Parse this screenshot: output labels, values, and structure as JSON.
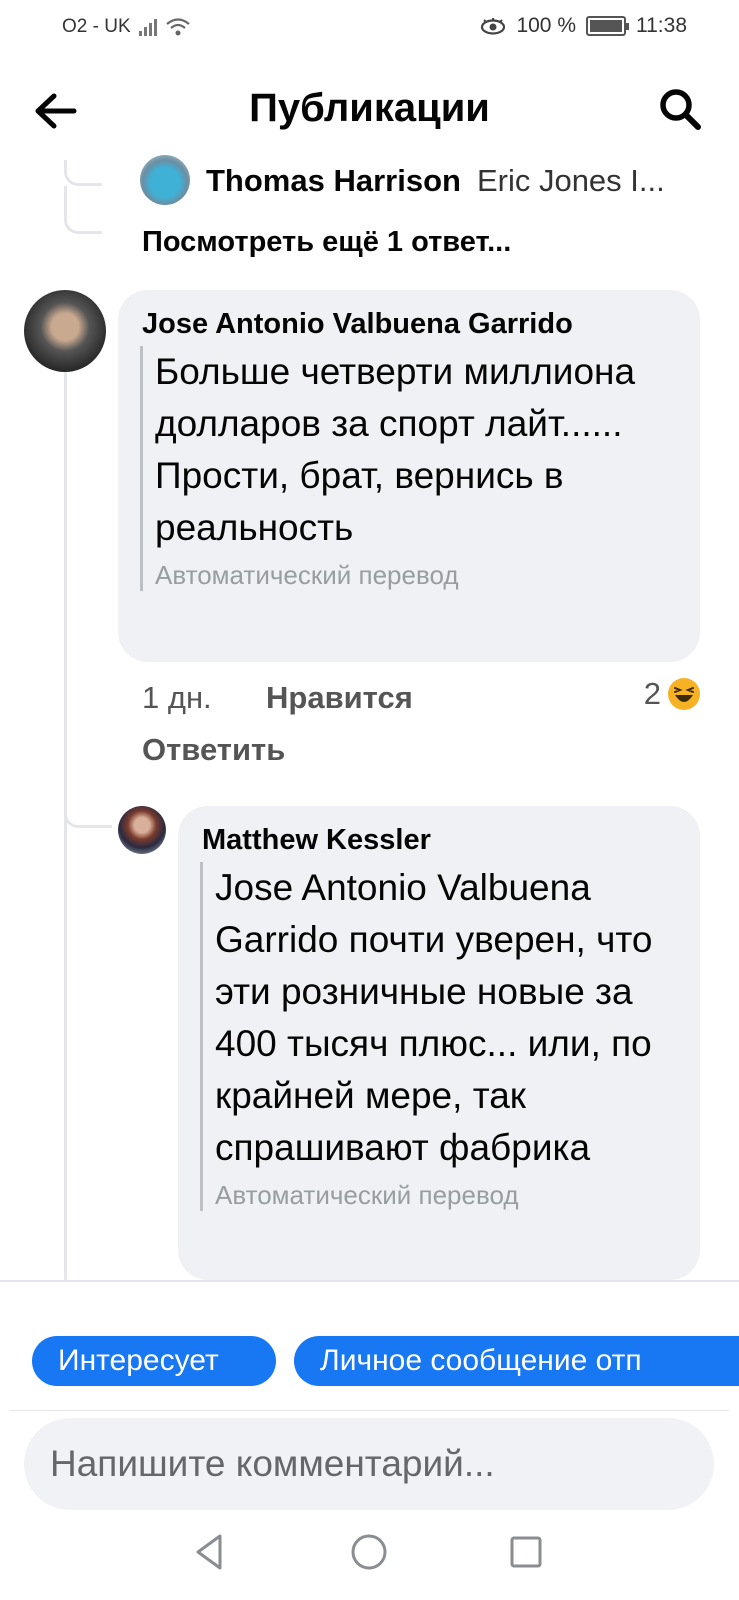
{
  "status_bar": {
    "carrier": "O2 - UK",
    "battery": "100 %",
    "time": "11:38",
    "icons": [
      "signal-icon",
      "wifi-icon",
      "eye-comfort-icon",
      "battery-icon"
    ]
  },
  "header": {
    "title": "Публикации",
    "back_icon": "arrow-left-icon",
    "search_icon": "search-icon"
  },
  "previous_reply": {
    "author": "Thomas Harrison",
    "snippet": "Eric Jones I..."
  },
  "more_replies_label": "Посмотреть ещё 1 ответ...",
  "comment": {
    "author": "Jose Antonio Valbuena Garrido",
    "text": "Больше четверти миллиона долларов за спорт лайт...... Прости, брат, вернись в реальность",
    "translation_label": "Автоматический перевод",
    "time": "1 дн.",
    "like_label": "Нравится",
    "reply_label": "Ответить",
    "reaction_count": "2",
    "reaction_icon": "haha-emoji-icon"
  },
  "reply": {
    "author": "Matthew Kessler",
    "text": "Jose Antonio Valbuena Garrido почти уверен, что эти розничные новые за 400 тысяч плюс... или, по крайней мере, так спрашивают фабрика",
    "translation_label": "Автоматический перевод"
  },
  "quick_replies": [
    "Интересует",
    "Личное сообщение отп"
  ],
  "composer": {
    "placeholder": "Напишите комментарий..."
  },
  "nav_bar": {
    "icons": [
      "back-triangle-icon",
      "home-circle-icon",
      "recents-square-icon"
    ]
  },
  "colors": {
    "accent": "#1877f2",
    "bubble": "#eff1f4",
    "muted_text": "#999da1"
  }
}
